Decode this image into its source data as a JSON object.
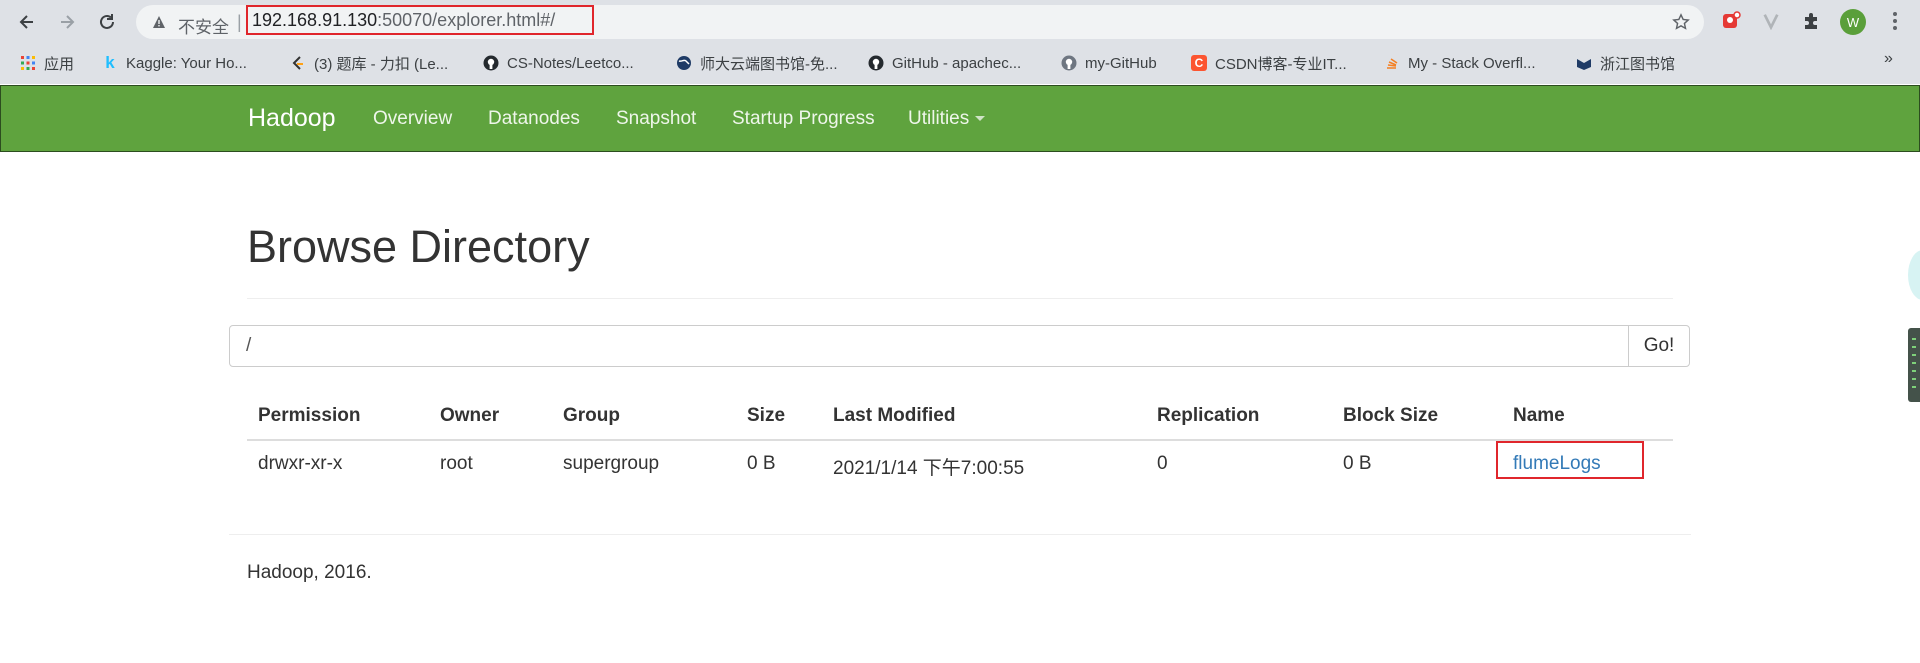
{
  "browser": {
    "insecure_label": "不安全",
    "separator": "|",
    "url_host": "192.168.91.130",
    "url_rest": ":50070/explorer.html#/",
    "avatar_letter": "W"
  },
  "bookmarks": [
    {
      "label": "应用",
      "icon": "apps-grid-icon"
    },
    {
      "label": "Kaggle: Your Ho...",
      "icon": "kaggle-icon"
    },
    {
      "label": "(3) 题库 - 力扣 (Le...",
      "icon": "leetcode-icon"
    },
    {
      "label": "CS-Notes/Leetco...",
      "icon": "github-icon"
    },
    {
      "label": "师大云端图书馆-免...",
      "icon": "globe-icon"
    },
    {
      "label": "GitHub - apachec...",
      "icon": "github-icon"
    },
    {
      "label": "my-GitHub",
      "icon": "github-icon"
    },
    {
      "label": "CSDN博客-专业IT...",
      "icon": "csdn-icon"
    },
    {
      "label": "My - Stack Overfl...",
      "icon": "stackoverflow-icon"
    },
    {
      "label": "浙江图书馆",
      "icon": "library-icon"
    }
  ],
  "bookmarks_more": "»",
  "navbar": {
    "brand": "Hadoop",
    "links": [
      "Overview",
      "Datanodes",
      "Snapshot",
      "Startup Progress",
      "Utilities"
    ]
  },
  "page": {
    "title": "Browse Directory",
    "path_value": "/",
    "go_label": "Go!"
  },
  "table": {
    "headers": [
      "Permission",
      "Owner",
      "Group",
      "Size",
      "Last Modified",
      "Replication",
      "Block Size",
      "Name"
    ],
    "rows": [
      {
        "permission": "drwxr-xr-x",
        "owner": "root",
        "group": "supergroup",
        "size": "0 B",
        "last_modified": "2021/1/14 下午7:00:55",
        "replication": "0",
        "block_size": "0 B",
        "name": "flumeLogs"
      }
    ]
  },
  "footer": "Hadoop, 2016.",
  "colors": {
    "navbar": "#5fa33e",
    "link": "#337ab7",
    "highlight": "#e0262c"
  }
}
